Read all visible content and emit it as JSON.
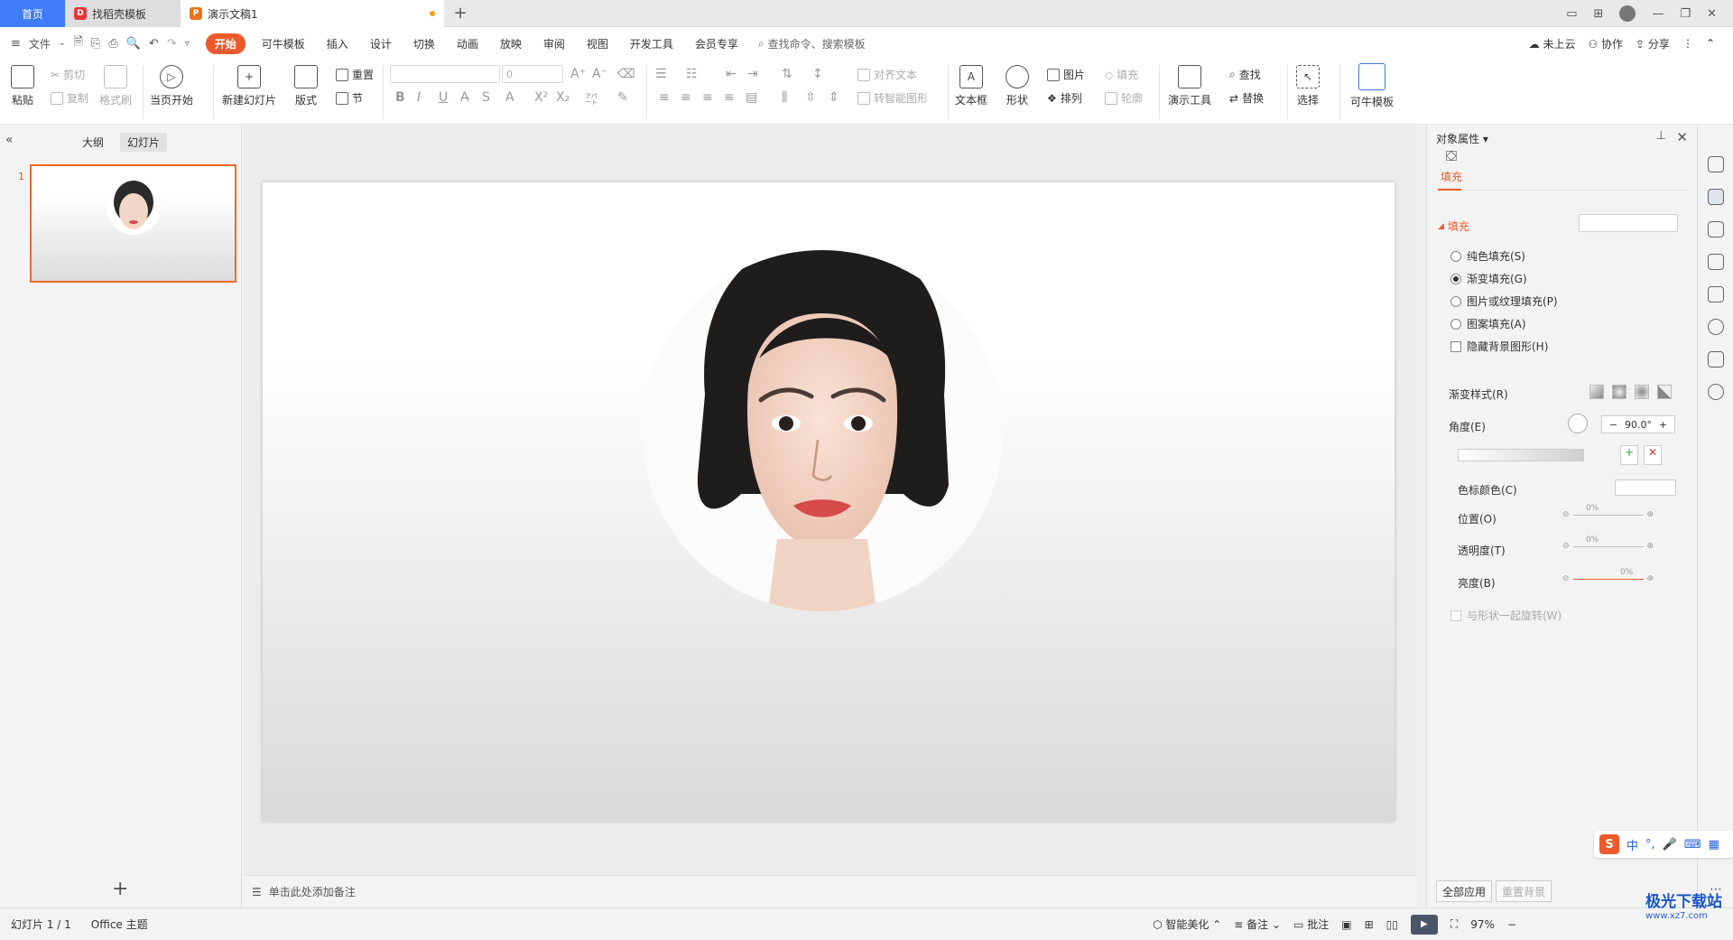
{
  "tabs": {
    "home": "首页",
    "t2": "找稻壳模板",
    "t3": "演示文稿1",
    "add": "+"
  },
  "menu": {
    "file": "文件",
    "items": [
      "开始",
      "可牛模板",
      "插入",
      "设计",
      "切换",
      "动画",
      "放映",
      "审阅",
      "视图",
      "开发工具",
      "会员专享"
    ],
    "search": "查找命令、搜索模板",
    "cloud": "未上云",
    "collab": "协作",
    "share": "分享"
  },
  "ribbon": {
    "paste": "粘贴",
    "cut": "剪切",
    "copy": "复制",
    "format_painter": "格式刷",
    "play_first": "当页开始",
    "new_slide": "新建幻灯片",
    "layout": "版式",
    "reset": "重置",
    "section": "节",
    "font_size": "0",
    "align_text": "对齐文本",
    "to_smartart": "转智能图形",
    "textbox": "文本框",
    "shape": "形状",
    "picture": "图片",
    "fill": "填充",
    "arrange": "排列",
    "outline": "轮廓",
    "present_tool": "演示工具",
    "find": "查找",
    "replace": "替换",
    "select": "选择",
    "keniu": "可牛模板"
  },
  "left": {
    "outline": "大纲",
    "slides": "幻灯片",
    "slide_num": "1"
  },
  "notes": "单击此处添加备注",
  "prop": {
    "title": "对象属性",
    "fill_tab": "填充",
    "section": "填充",
    "options": [
      "纯色填充(S)",
      "渐变填充(G)",
      "图片或纹理填充(P)",
      "图案填充(A)"
    ],
    "hide_bg": "隐藏背景图形(H)",
    "grad_style": "渐变样式(R)",
    "angle": "角度(E)",
    "angle_val": "90.0°",
    "stop_color": "色标颜色(C)",
    "position": "位置(O)",
    "transparency": "透明度(T)",
    "brightness": "亮度(B)",
    "pos_val": "0%",
    "trans_val": "0%",
    "bright_val": "0%",
    "rotate_with": "与形状一起旋转(W)",
    "apply_all": "全部应用",
    "reset_bg": "重置背景"
  },
  "status": {
    "slide": "幻灯片 1 / 1",
    "theme": "Office 主题",
    "beautify": "智能美化",
    "notes": "备注",
    "comment": "批注",
    "zoom": "97%"
  },
  "ime": {
    "s": "S",
    "lang": "中"
  },
  "watermark": {
    "name": "极光下载站",
    "url": "www.xz7.com"
  }
}
